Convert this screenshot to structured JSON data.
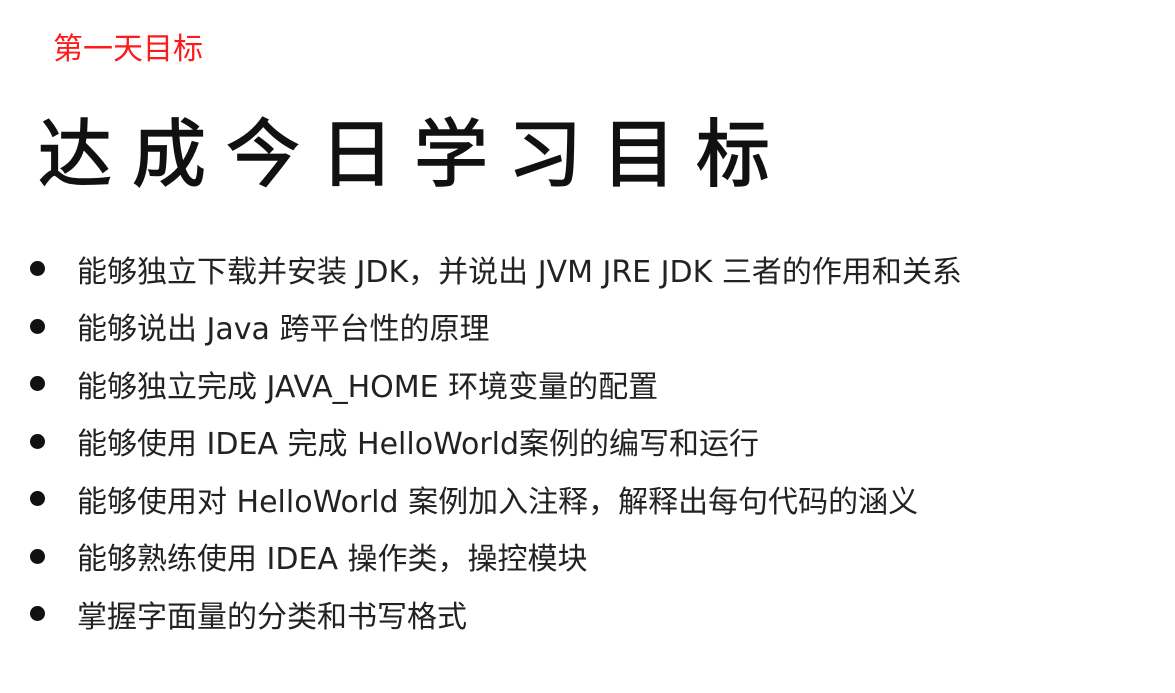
{
  "header": {
    "day_label": "第一天目标",
    "day_label_color": "#ff1a1a",
    "title": "达成今日学习目标"
  },
  "goals": [
    "能够独立下载并安装 JDK，并说出 JVM JRE JDK 三者的作用和关系",
    "能够说出 Java 跨平台性的原理",
    "能够独立完成 JAVA_HOME 环境变量的配置",
    "能够使用 IDEA 完成 HelloWorld案例的编写和运行",
    "能够使用对 HelloWorld 案例加入注释，解释出每句代码的涵义",
    "能够熟练使用 IDEA 操作类，操控模块",
    "掌握字面量的分类和书写格式"
  ]
}
